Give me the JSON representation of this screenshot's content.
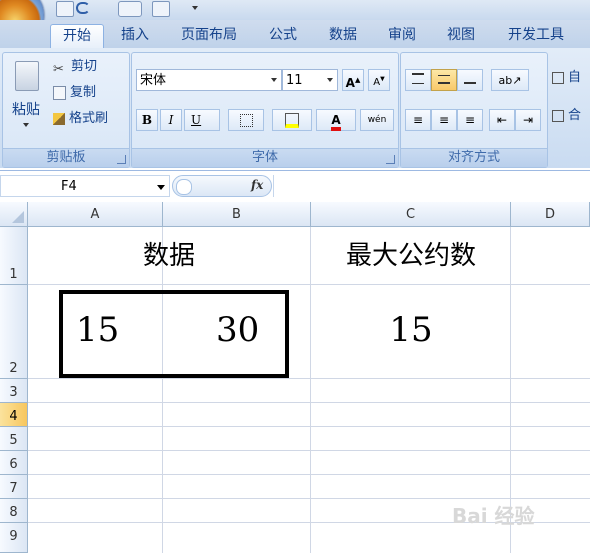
{
  "ribbon": {
    "tabs": [
      "开始",
      "插入",
      "页面布局",
      "公式",
      "数据",
      "审阅",
      "视图",
      "开发工具"
    ],
    "clipboard": {
      "paste_label": "粘贴",
      "cut_label": "剪切",
      "copy_label": "复制",
      "format_painter_label": "格式刷",
      "group_label": "剪贴板"
    },
    "font": {
      "font_name": "宋体",
      "font_size": "11",
      "bold": "B",
      "italic": "I",
      "underline": "U",
      "phonetic": "wén",
      "group_label": "字体"
    },
    "alignment": {
      "group_label": "对齐方式",
      "wrap_label": "自",
      "merge_label": "合"
    }
  },
  "formula_bar": {
    "name_box": "F4",
    "fx_label": "fx",
    "formula": ""
  },
  "sheet": {
    "columns": [
      "A",
      "B",
      "C",
      "D"
    ],
    "rows": [
      "1",
      "2",
      "3",
      "4",
      "5",
      "6",
      "7",
      "8",
      "9"
    ],
    "selected_row": "4",
    "cells": {
      "A1": "数据",
      "C1": "最大公约数",
      "A2": "15",
      "B2": "30",
      "C2": "15"
    }
  },
  "watermark": "Bai 经验"
}
